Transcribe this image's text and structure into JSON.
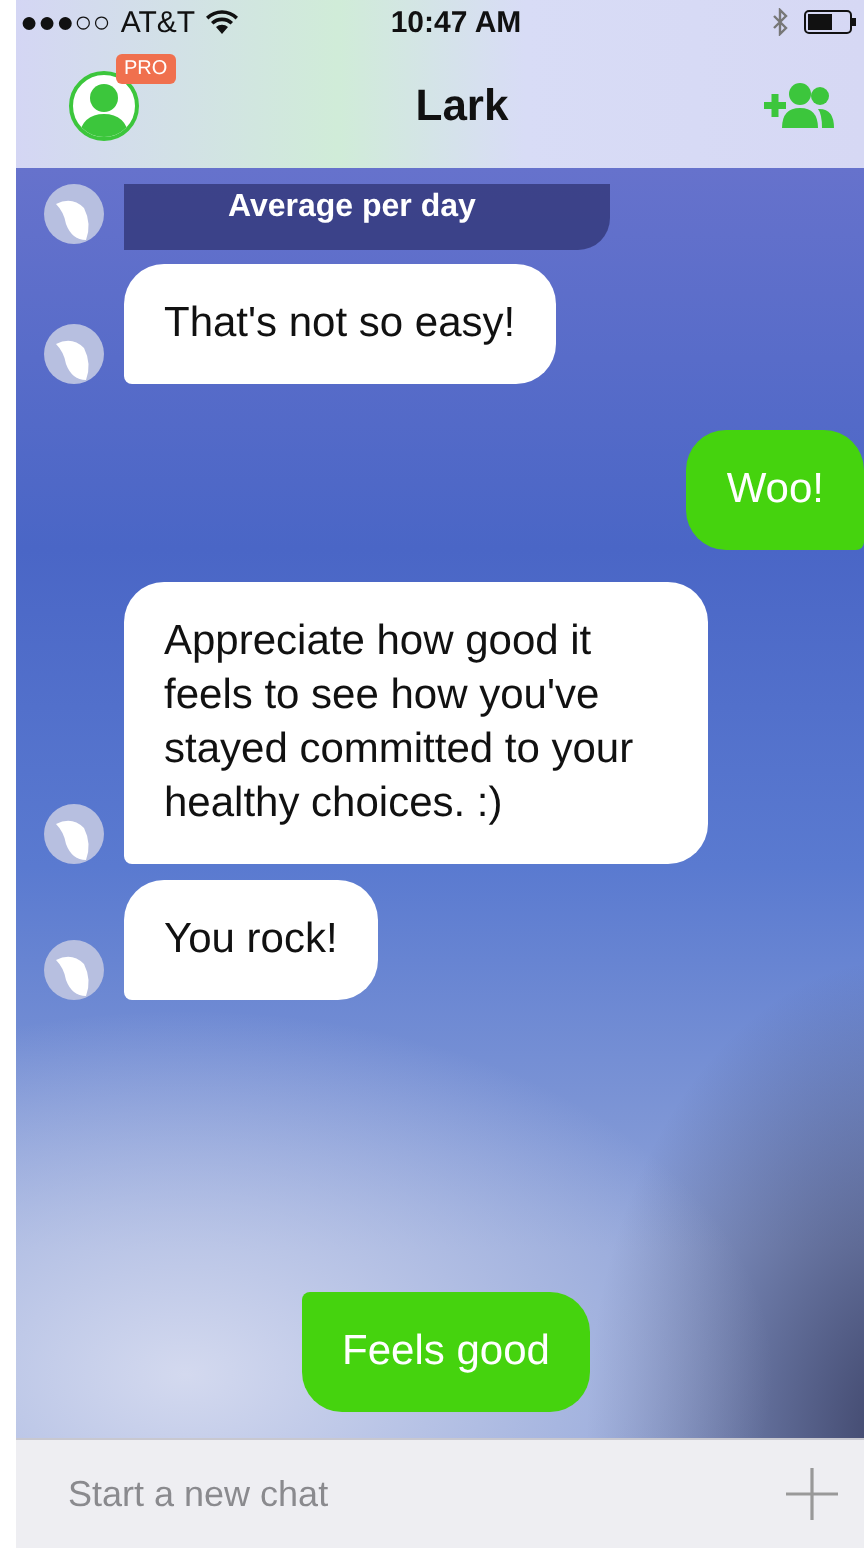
{
  "status_bar": {
    "signal": "●●●○○",
    "carrier": "AT&T",
    "time": "10:47 AM"
  },
  "nav_bar": {
    "badge": "PRO",
    "title": "Lark"
  },
  "messages": [
    {
      "kind": "card",
      "text": "Average per day"
    },
    {
      "kind": "bot",
      "text": "That's not so easy!"
    },
    {
      "kind": "user",
      "text": "Woo!"
    },
    {
      "kind": "bot",
      "text": "Appreciate how good it feels to see how you've stayed committed to your healthy choices. :)"
    },
    {
      "kind": "bot",
      "text": "You rock!"
    },
    {
      "kind": "reply",
      "text": "Feels good"
    }
  ],
  "composer": {
    "placeholder": "Start a new chat"
  }
}
